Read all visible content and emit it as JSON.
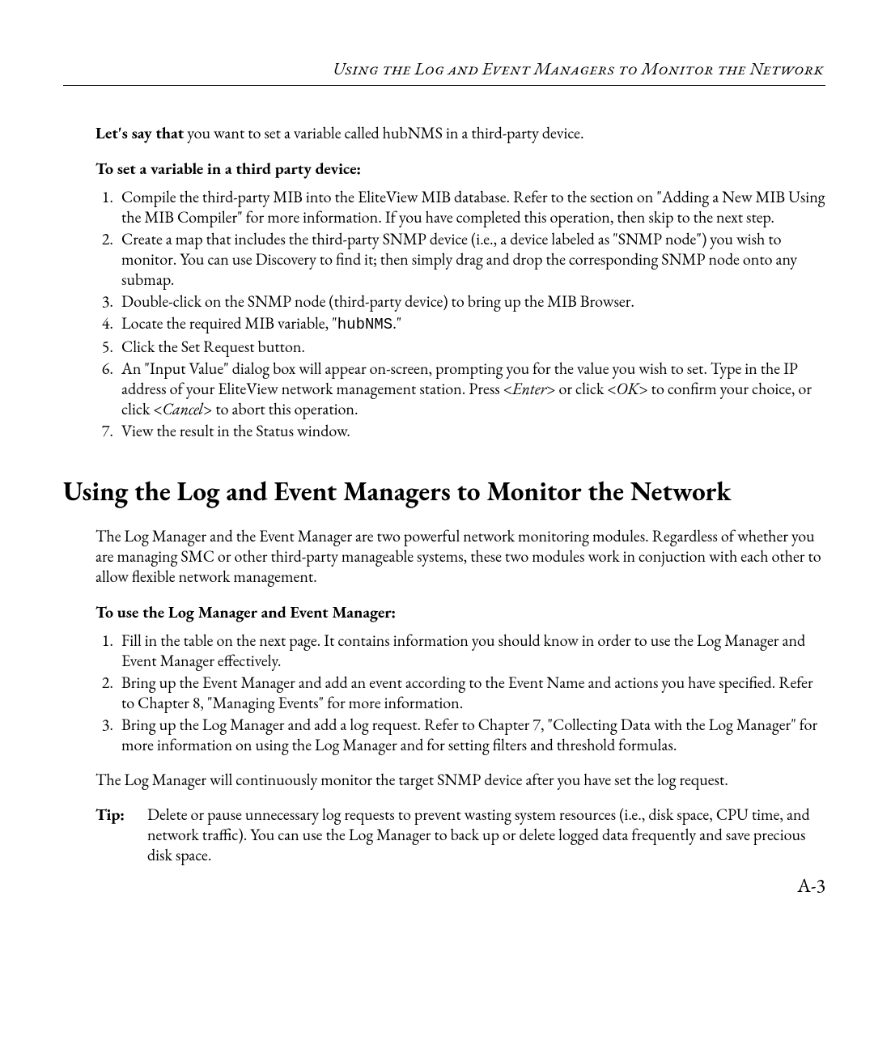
{
  "running_head": "Using the Log and Event Managers to Monitor the Network",
  "intro": {
    "lead": "Let's say that",
    "rest": " you want to set a variable called hubNMS in a third-party device."
  },
  "subhead1": "To set a variable in a third party device:",
  "steps1": {
    "s1": "Compile the third-party MIB into the EliteView MIB database. Refer to the section on \"Adding a New MIB Using the MIB Compiler\" for more information. If you have completed this operation, then skip to the next step.",
    "s2": "Create a map that includes the third-party SNMP device (i.e., a device labeled as \"SNMP node\") you wish to monitor. You can use Discovery to find it; then simply drag and drop the corresponding SNMP node onto any submap.",
    "s3": "Double-click on the SNMP node (third-party device) to bring up the MIB Browser.",
    "s4_pre": "Locate the required MIB variable, \"",
    "s4_code": "hubNMS",
    "s4_post": ".\"",
    "s5": "Click the Set Request button.",
    "s6_a": "An \"Input Value\" dialog box will appear on-screen, prompting you for the value you wish to set. Type in the IP address of your EliteView network management station. Press <",
    "s6_enter": "Enter",
    "s6_b": "> or click <",
    "s6_ok": "OK",
    "s6_c": "> to confirm your choice, or click <",
    "s6_cancel": "Cancel",
    "s6_d": "> to abort this operation.",
    "s7": "View the result in the Status window."
  },
  "section_title": "Using the Log and Event Managers to Monitor the Network",
  "section_intro": "The Log Manager and the Event Manager are two powerful network monitoring modules. Regardless of whether you are managing SMC or other third-party manageable systems, these two modules work in conjuction with each other to allow flexible network management.",
  "subhead2": "To use the Log Manager and Event Manager:",
  "steps2": {
    "s1": "Fill in the table on the next page. It contains information you should know in order to use the Log Manager and Event Manager effectively.",
    "s2": "Bring up the Event Manager and add an event according to the Event Name and actions you have specified. Refer to Chapter 8, \"Managing Events\" for more information.",
    "s3": "Bring up the Log Manager and add a log request. Refer to Chapter 7, \"Collecting Data with the Log Manager\" for more information on using the Log Manager and for setting filters and threshold formulas."
  },
  "followup": "The Log Manager will continuously monitor the target SNMP device after you have set the log request.",
  "tip": {
    "label": "Tip:",
    "text": "Delete or pause unnecessary log requests to prevent wasting system resources (i.e., disk space, CPU time, and network traffic). You can use the Log Manager to back up or delete logged data frequently and save precious disk space."
  },
  "page_number": "A-3"
}
